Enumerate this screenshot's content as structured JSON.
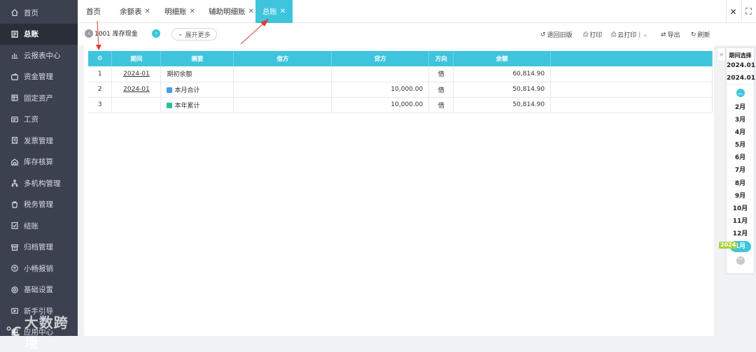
{
  "sidebar": {
    "items": [
      {
        "label": "首页",
        "icon": "home-icon"
      },
      {
        "label": "总账",
        "icon": "ledger-icon"
      },
      {
        "label": "云报表中心",
        "icon": "chart-icon"
      },
      {
        "label": "资金管理",
        "icon": "wallet-icon"
      },
      {
        "label": "固定资产",
        "icon": "asset-icon"
      },
      {
        "label": "工资",
        "icon": "salary-icon"
      },
      {
        "label": "发票管理",
        "icon": "invoice-icon"
      },
      {
        "label": "库存核算",
        "icon": "warehouse-icon"
      },
      {
        "label": "多机构管理",
        "icon": "org-icon"
      },
      {
        "label": "税务管理",
        "icon": "tax-icon"
      },
      {
        "label": "结账",
        "icon": "close-books-icon"
      },
      {
        "label": "归档管理",
        "icon": "archive-icon"
      },
      {
        "label": "小畅报销",
        "icon": "reimburse-icon"
      },
      {
        "label": "基础设置",
        "icon": "settings-icon"
      },
      {
        "label": "新手引导",
        "icon": "guide-icon"
      },
      {
        "label": "应用中心",
        "icon": "apps-icon"
      }
    ],
    "active_index": 1
  },
  "watermark": {
    "text": "大数跨境",
    "logo": "℃"
  },
  "tabs": [
    {
      "label": "首页",
      "closable": false
    },
    {
      "label": "余额表",
      "closable": true
    },
    {
      "label": "明细账",
      "closable": true
    },
    {
      "label": "辅助明细账",
      "closable": true
    },
    {
      "label": "总账",
      "closable": true
    }
  ],
  "active_tab": 4,
  "window_controls": {
    "close": "✕",
    "fullscreen": "⛶"
  },
  "toolbar": {
    "account": "1001 库存现金",
    "expand_label": "展开更多",
    "buttons": [
      {
        "label": "退回旧版",
        "icon": "undo-icon"
      },
      {
        "label": "打印",
        "icon": "print-icon"
      },
      {
        "label": "云打印",
        "icon": "cloud-print-icon"
      },
      {
        "label": "导出",
        "icon": "export-icon"
      },
      {
        "label": "刷新",
        "icon": "refresh-icon"
      }
    ]
  },
  "table": {
    "columns": [
      "",
      "期间",
      "摘要",
      "借方",
      "贷方",
      "方向",
      "余额",
      ""
    ],
    "rows": [
      {
        "no": "1",
        "period": "2024-01",
        "summary": "期初余额",
        "badge": "",
        "debit": "",
        "credit": "",
        "direction": "借",
        "balance": "60,814.90"
      },
      {
        "no": "2",
        "period": "2024-01",
        "summary": "本月合计",
        "badge": "month",
        "debit": "",
        "credit": "10,000.00",
        "direction": "借",
        "balance": "50,814.90"
      },
      {
        "no": "3",
        "period": "",
        "summary": "本年累计",
        "badge": "year",
        "debit": "",
        "credit": "10,000.00",
        "direction": "借",
        "balance": "50,814.90"
      }
    ]
  },
  "period_picker": {
    "title": "期间选择",
    "range_start": "2024.01",
    "range_end": "2024.01",
    "months": [
      "2月",
      "3月",
      "4月",
      "5月",
      "6月",
      "7月",
      "8月",
      "9月",
      "10月",
      "11月",
      "12月",
      "1月"
    ],
    "selected_month": "1月",
    "year_tag": "2024"
  },
  "colors": {
    "accent": "#3ec5dd",
    "sidebar": "#3c4150",
    "annotation": "#e53935",
    "year_tag": "#a8d23a"
  }
}
